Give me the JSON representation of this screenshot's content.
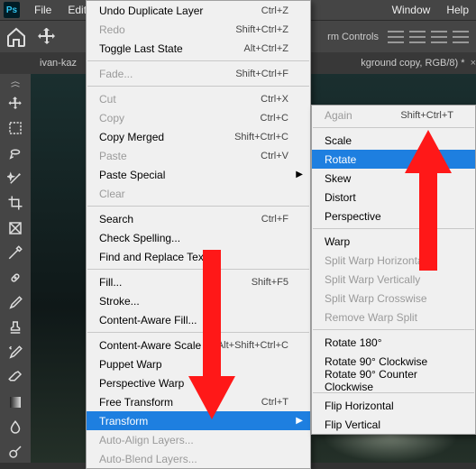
{
  "menubar": {
    "items": [
      "File",
      "Edit"
    ],
    "right": [
      "Window",
      "Help"
    ]
  },
  "optbar": {
    "label": "rm Controls"
  },
  "tab_left": "ivan-kaz",
  "tab_right": "kground copy, RGB/8) *",
  "edit_menu": {
    "undo": "Undo Duplicate Layer",
    "undo_sc": "Ctrl+Z",
    "redo": "Redo",
    "redo_sc": "Shift+Ctrl+Z",
    "toggle": "Toggle Last State",
    "toggle_sc": "Alt+Ctrl+Z",
    "fade": "Fade...",
    "fade_sc": "Shift+Ctrl+F",
    "cut": "Cut",
    "cut_sc": "Ctrl+X",
    "copy": "Copy",
    "copy_sc": "Ctrl+C",
    "copym": "Copy Merged",
    "copym_sc": "Shift+Ctrl+C",
    "paste": "Paste",
    "paste_sc": "Ctrl+V",
    "pastes": "Paste Special",
    "clear": "Clear",
    "search": "Search",
    "search_sc": "Ctrl+F",
    "spell": "Check Spelling...",
    "find": "Find and Replace Text...",
    "fill": "Fill...",
    "fill_sc": "Shift+F5",
    "stroke": "Stroke...",
    "caf": "Content-Aware Fill...",
    "cas": "Content-Aware Scale",
    "cas_sc": "Alt+Shift+Ctrl+C",
    "puppet": "Puppet Warp",
    "persp": "Perspective Warp",
    "ft": "Free Transform",
    "ft_sc": "Ctrl+T",
    "transform": "Transform",
    "aal": "Auto-Align Layers...",
    "abl": "Auto-Blend Layers..."
  },
  "transform_menu": {
    "again": "Again",
    "again_sc": "Shift+Ctrl+T",
    "scale": "Scale",
    "rotate": "Rotate",
    "skew": "Skew",
    "distort": "Distort",
    "perspective": "Perspective",
    "warp": "Warp",
    "swh": "Split Warp Horizontally",
    "swv": "Split Warp Vertically",
    "swc": "Split Warp Crosswise",
    "rws": "Remove Warp Split",
    "r180": "Rotate 180°",
    "r90cw": "Rotate 90° Clockwise",
    "r90ccw": "Rotate 90° Counter Clockwise",
    "fliph": "Flip Horizontal",
    "flipv": "Flip Vertical"
  }
}
